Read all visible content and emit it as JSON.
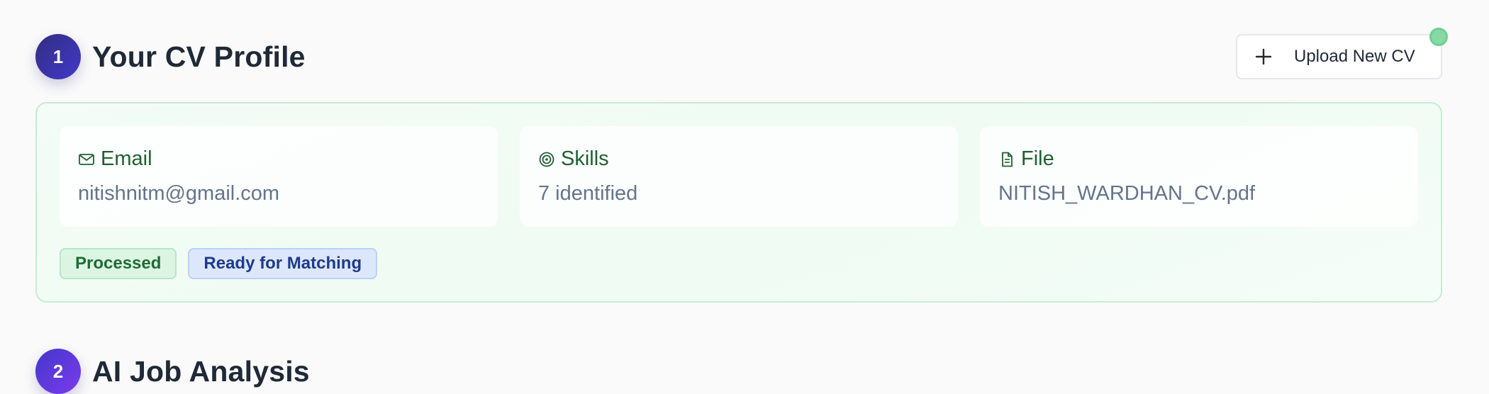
{
  "sections": [
    {
      "number": "1",
      "title": "Your CV Profile"
    },
    {
      "number": "2",
      "title": "AI Job Analysis"
    }
  ],
  "upload_button": {
    "label": "Upload New CV",
    "icon": "plus-icon"
  },
  "profile": {
    "email": {
      "label": "Email",
      "value": "nitishnitm@gmail.com",
      "icon": "mail-icon"
    },
    "skills": {
      "label": "Skills",
      "value": "7 identified",
      "icon": "target-icon"
    },
    "file": {
      "label": "File",
      "value": "NITISH_WARDHAN_CV.pdf",
      "icon": "document-icon"
    }
  },
  "badges": {
    "processed": "Processed",
    "ready": "Ready for Matching"
  },
  "colors": {
    "accent_indigo": "#312e81",
    "card_green_border": "#c7ecd2",
    "tile_label_green": "#1f5f32",
    "status_dot": "#86d9a5"
  }
}
